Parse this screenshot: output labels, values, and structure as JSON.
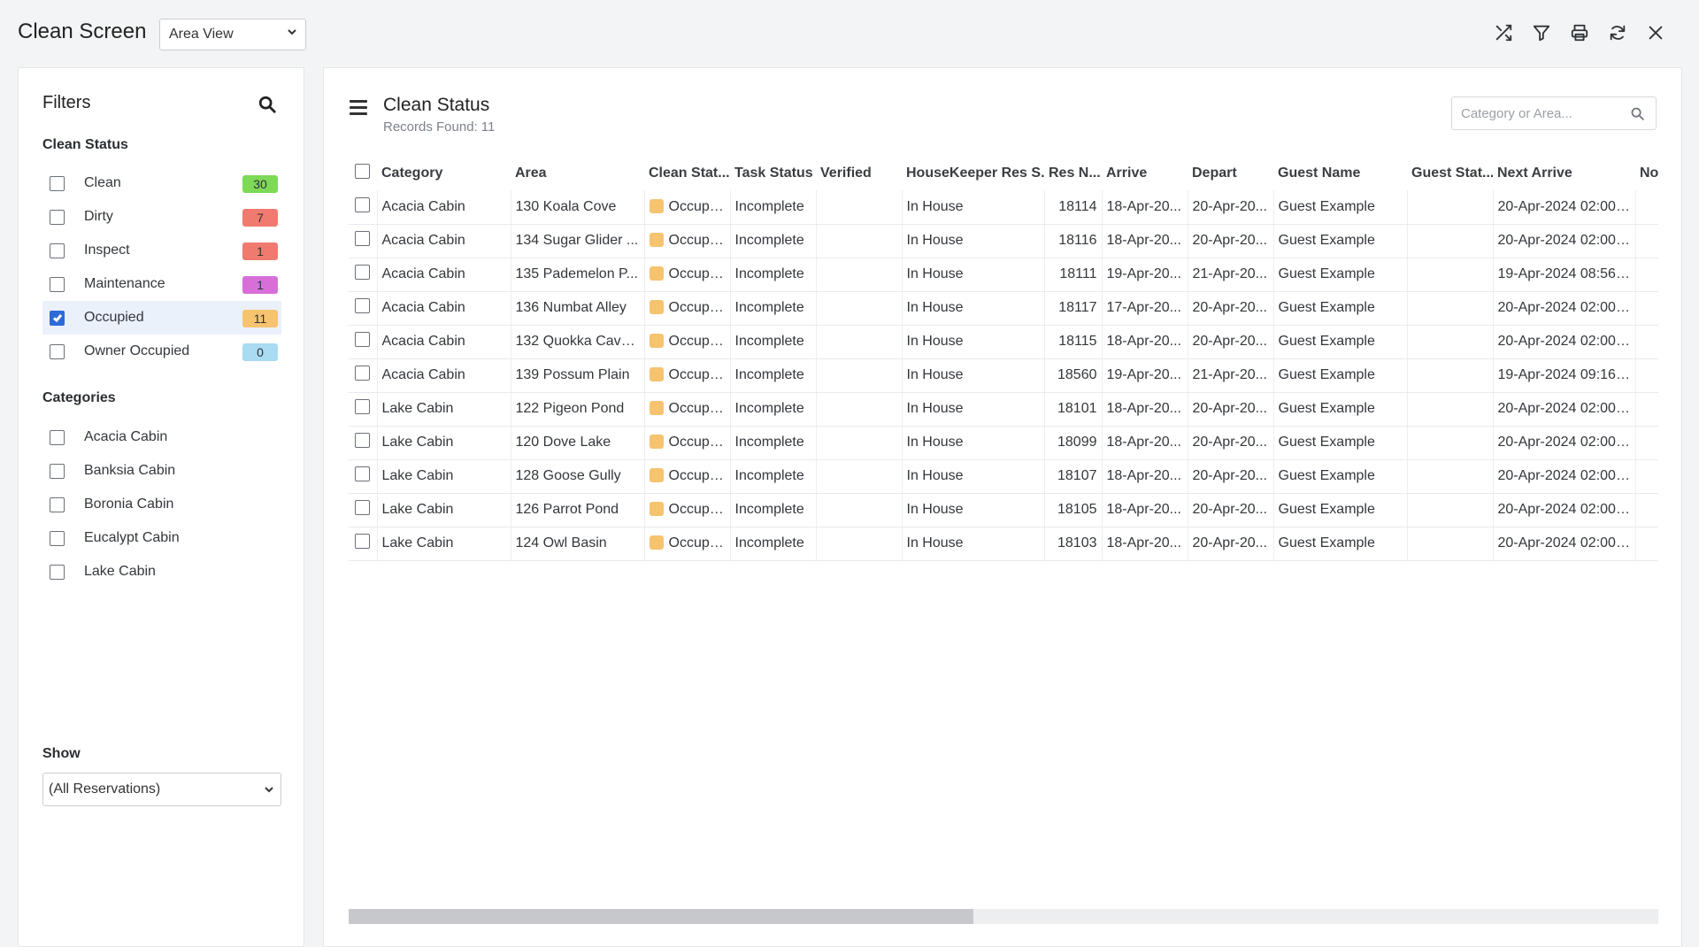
{
  "app": {
    "title": "Clean Screen",
    "view_select": "Area View"
  },
  "toolbar": {
    "icons": [
      "shuffle-icon",
      "filter-icon",
      "print-icon",
      "refresh-icon",
      "close-icon"
    ]
  },
  "filters": {
    "title": "Filters",
    "clean_status_heading": "Clean Status",
    "clean_status": [
      {
        "label": "Clean",
        "count": "30",
        "checked": false,
        "color": "#7ed957"
      },
      {
        "label": "Dirty",
        "count": "7",
        "checked": false,
        "color": "#f07a6f"
      },
      {
        "label": "Inspect",
        "count": "1",
        "checked": false,
        "color": "#f07a6f"
      },
      {
        "label": "Maintenance",
        "count": "1",
        "checked": false,
        "color": "#d86fd9"
      },
      {
        "label": "Occupied",
        "count": "11",
        "checked": true,
        "color": "#f6c36f"
      },
      {
        "label": "Owner Occupied",
        "count": "0",
        "checked": false,
        "color": "#a9dbf2"
      }
    ],
    "categories_heading": "Categories",
    "categories": [
      {
        "label": "Acacia Cabin"
      },
      {
        "label": "Banksia Cabin"
      },
      {
        "label": "Boronia Cabin"
      },
      {
        "label": "Eucalypt Cabin"
      },
      {
        "label": "Lake Cabin"
      }
    ],
    "show_label": "Show",
    "show_value": "(All Reservations)"
  },
  "main": {
    "title": "Clean Status",
    "records_label": "Records Found:",
    "records_count": "11",
    "search_placeholder": "Category or Area...",
    "columns": [
      "Category",
      "Area",
      "Clean Stat...",
      "Task Status",
      "Verified",
      "HouseKeeper Res S...",
      "Res N...",
      "Arrive",
      "Depart",
      "Guest Name",
      "Guest Stat...",
      "Next Arrive",
      "No"
    ],
    "rows": [
      {
        "category": "Acacia Cabin",
        "area": "130 Koala Cove",
        "clean_status": "Occupied",
        "task_status": "Incomplete",
        "verified": "",
        "hk_res_status": "In House",
        "res_no": "18114",
        "arrive": "18-Apr-20...",
        "depart": "20-Apr-20...",
        "guest_name": "Guest Example",
        "guest_status": "",
        "next_arrive": "20-Apr-2024 02:00 ...",
        "no": ""
      },
      {
        "category": "Acacia Cabin",
        "area": "134 Sugar Glider ...",
        "clean_status": "Occupied",
        "task_status": "Incomplete",
        "verified": "",
        "hk_res_status": "In House",
        "res_no": "18116",
        "arrive": "18-Apr-20...",
        "depart": "20-Apr-20...",
        "guest_name": "Guest Example",
        "guest_status": "",
        "next_arrive": "20-Apr-2024 02:00 ...",
        "no": ""
      },
      {
        "category": "Acacia Cabin",
        "area": "135 Pademelon P...",
        "clean_status": "Occupied",
        "task_status": "Incomplete",
        "verified": "",
        "hk_res_status": "In House",
        "res_no": "18111",
        "arrive": "19-Apr-20...",
        "depart": "21-Apr-20...",
        "guest_name": "Guest Example",
        "guest_status": "",
        "next_arrive": "19-Apr-2024 08:56 ...",
        "no": ""
      },
      {
        "category": "Acacia Cabin",
        "area": "136 Numbat Alley",
        "clean_status": "Occupied",
        "task_status": "Incomplete",
        "verified": "",
        "hk_res_status": "In House",
        "res_no": "18117",
        "arrive": "17-Apr-20...",
        "depart": "20-Apr-20...",
        "guest_name": "Guest Example",
        "guest_status": "",
        "next_arrive": "20-Apr-2024 02:00 ...",
        "no": ""
      },
      {
        "category": "Acacia Cabin",
        "area": "132 Quokka Cavern",
        "clean_status": "Occupied",
        "task_status": "Incomplete",
        "verified": "",
        "hk_res_status": "In House",
        "res_no": "18115",
        "arrive": "18-Apr-20...",
        "depart": "20-Apr-20...",
        "guest_name": "Guest Example",
        "guest_status": "",
        "next_arrive": "20-Apr-2024 02:00 ...",
        "no": ""
      },
      {
        "category": "Acacia Cabin",
        "area": "139 Possum Plain",
        "clean_status": "Occupied",
        "task_status": "Incomplete",
        "verified": "",
        "hk_res_status": "In House",
        "res_no": "18560",
        "arrive": "19-Apr-20...",
        "depart": "21-Apr-20...",
        "guest_name": "Guest Example",
        "guest_status": "",
        "next_arrive": "19-Apr-2024 09:16 ...",
        "no": ""
      },
      {
        "category": "Lake Cabin",
        "area": "122 Pigeon Pond",
        "clean_status": "Occupied",
        "task_status": "Incomplete",
        "verified": "",
        "hk_res_status": "In House",
        "res_no": "18101",
        "arrive": "18-Apr-20...",
        "depart": "20-Apr-20...",
        "guest_name": "Guest Example",
        "guest_status": "",
        "next_arrive": "20-Apr-2024 02:00 ...",
        "no": ""
      },
      {
        "category": "Lake Cabin",
        "area": "120 Dove Lake",
        "clean_status": "Occupied",
        "task_status": "Incomplete",
        "verified": "",
        "hk_res_status": "In House",
        "res_no": "18099",
        "arrive": "18-Apr-20...",
        "depart": "20-Apr-20...",
        "guest_name": "Guest Example",
        "guest_status": "",
        "next_arrive": "20-Apr-2024 02:00 ...",
        "no": ""
      },
      {
        "category": "Lake Cabin",
        "area": "128 Goose Gully",
        "clean_status": "Occupied",
        "task_status": "Incomplete",
        "verified": "",
        "hk_res_status": "In House",
        "res_no": "18107",
        "arrive": "18-Apr-20...",
        "depart": "20-Apr-20...",
        "guest_name": "Guest Example",
        "guest_status": "",
        "next_arrive": "20-Apr-2024 02:00 ...",
        "no": ""
      },
      {
        "category": "Lake Cabin",
        "area": "126 Parrot Pond",
        "clean_status": "Occupied",
        "task_status": "Incomplete",
        "verified": "",
        "hk_res_status": "In House",
        "res_no": "18105",
        "arrive": "18-Apr-20...",
        "depart": "20-Apr-20...",
        "guest_name": "Guest Example",
        "guest_status": "",
        "next_arrive": "20-Apr-2024 02:00 ...",
        "no": ""
      },
      {
        "category": "Lake Cabin",
        "area": "124 Owl Basin",
        "clean_status": "Occupied",
        "task_status": "Incomplete",
        "verified": "",
        "hk_res_status": "In House",
        "res_no": "18103",
        "arrive": "18-Apr-20...",
        "depart": "20-Apr-20...",
        "guest_name": "Guest Example",
        "guest_status": "",
        "next_arrive": "20-Apr-2024 02:00 ...",
        "no": ""
      }
    ],
    "scroll_position": 0.477
  },
  "colors": {
    "accent": "#2d6ad6",
    "occupied": "#f6c36f",
    "selected_row": "#eaf1fb"
  }
}
